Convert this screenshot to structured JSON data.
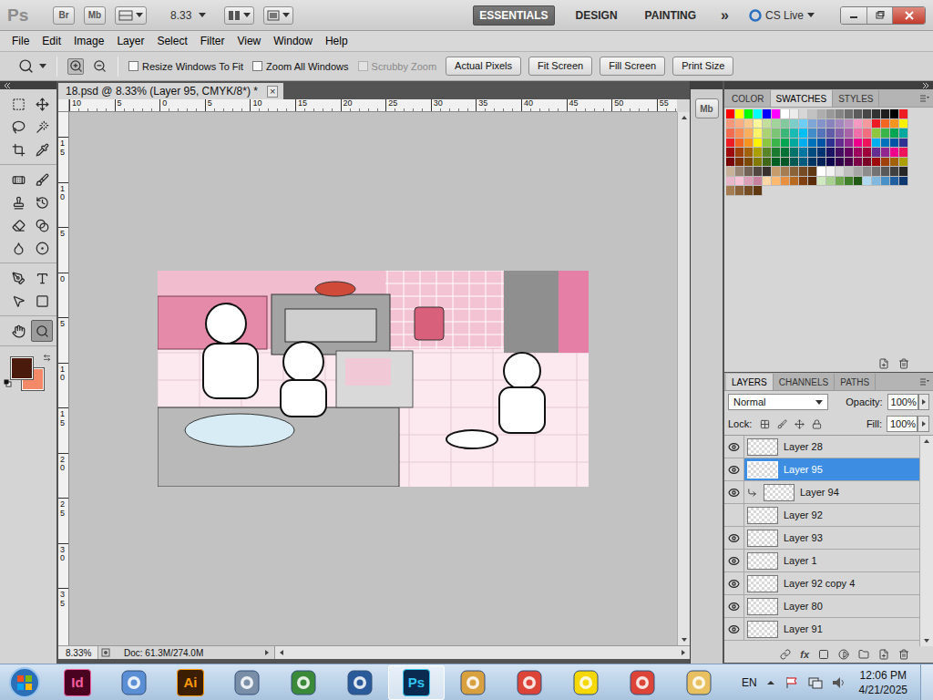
{
  "app_bar": {
    "logo": "Ps",
    "bridge": "Br",
    "mini_bridge": "Mb",
    "zoom": "8.33",
    "workspaces": [
      {
        "label": "ESSENTIALS",
        "selected": true
      },
      {
        "label": "DESIGN",
        "selected": false
      },
      {
        "label": "PAINTING",
        "selected": false
      }
    ],
    "more": "»",
    "cs_live": "CS Live"
  },
  "menu": [
    "File",
    "Edit",
    "Image",
    "Layer",
    "Select",
    "Filter",
    "View",
    "Window",
    "Help"
  ],
  "options": {
    "zoom_modes": [
      {
        "selected": true
      },
      {
        "selected": false
      }
    ],
    "checkboxes": [
      {
        "label": "Resize Windows To Fit",
        "checked": false,
        "disabled": false
      },
      {
        "label": "Zoom All Windows",
        "checked": false,
        "disabled": false
      },
      {
        "label": "Scrubby Zoom",
        "checked": false,
        "disabled": true
      }
    ],
    "buttons": [
      "Actual Pixels",
      "Fit Screen",
      "Fill Screen",
      "Print Size"
    ]
  },
  "tools": [
    {
      "selected": false
    },
    {
      "selected": false
    },
    {
      "selected": false
    },
    {
      "selected": false
    },
    {
      "selected": false
    },
    {
      "selected": false
    },
    {
      "selected": false
    },
    {
      "selected": false
    },
    {
      "selected": false
    },
    {
      "selected": false
    },
    {
      "selected": false
    },
    {
      "selected": false
    },
    {
      "selected": false
    },
    {
      "selected": false
    },
    {
      "selected": false
    },
    {
      "selected": false
    },
    {
      "selected": false
    },
    {
      "selected": false
    },
    {
      "selected": false
    },
    {
      "selected": true
    }
  ],
  "colors": {
    "foreground": "#4a1a0c",
    "background": "#f4896a"
  },
  "document": {
    "tab": "18.psd @ 8.33% (Layer 95, CMYK/8*) *",
    "close": "×",
    "ruler_top": [
      "10",
      "5",
      "0",
      "5",
      "10",
      "15",
      "20",
      "25",
      "30",
      "35",
      "40",
      "45",
      "50",
      "55"
    ],
    "ruler_left": [
      "15",
      "10",
      "5",
      "0",
      "5",
      "10",
      "15",
      "20",
      "25",
      "30",
      "35"
    ],
    "zoom": "8.33%",
    "info": "Doc: 61.3M/274.0M"
  },
  "dock": {
    "label": "Mb"
  },
  "swatches_panel": {
    "tabs": [
      {
        "label": "COLOR",
        "selected": false
      },
      {
        "label": "SWATCHES",
        "selected": true
      },
      {
        "label": "STYLES",
        "selected": false
      }
    ],
    "swatches": [
      [
        "#ff0000",
        "#ffff00",
        "#00ff00",
        "#00ffff",
        "#0000ff",
        "#ff00ff",
        "#ffffff",
        "#ebebeb",
        "#d6d6d6",
        "#c2c2c2",
        "#adadad",
        "#999999",
        "#858585",
        "#707070",
        "#5c5c5c",
        "#474747",
        "#333333",
        "#1f1f1f",
        "#000000",
        "#ee1d24"
      ],
      [
        "#f7977a",
        "#f9ad81",
        "#fdc68a",
        "#fff79a",
        "#c4df9b",
        "#a3d39c",
        "#82ca9d",
        "#7bcdc8",
        "#6ecff6",
        "#7ea7d8",
        "#8493ca",
        "#8882be",
        "#a187be",
        "#bc8dbf",
        "#f49ac2",
        "#f6989d",
        "#ed1c24",
        "#f26522",
        "#f7941d",
        "#fff200"
      ],
      [
        "#f26c4f",
        "#f68e55",
        "#fbaf5c",
        "#fff467",
        "#acd372",
        "#7cc576",
        "#3bb878",
        "#1abbb4",
        "#00bff3",
        "#438cca",
        "#5574b9",
        "#605ca8",
        "#855fa8",
        "#a763a8",
        "#f06ea9",
        "#f26d7d",
        "#8dc73f",
        "#39b54a",
        "#00a651",
        "#00a99d"
      ],
      [
        "#ed1c24",
        "#f26522",
        "#f7941d",
        "#fff200",
        "#8dc73f",
        "#39b54a",
        "#00a651",
        "#00a99d",
        "#00aeef",
        "#0072bc",
        "#0054a6",
        "#2e3192",
        "#662d91",
        "#92278f",
        "#ec008c",
        "#ed145b",
        "#00aeef",
        "#0072bc",
        "#0054a6",
        "#2e3192"
      ],
      [
        "#9e0b0f",
        "#a0410d",
        "#a36209",
        "#aba000",
        "#598527",
        "#1a7b30",
        "#007236",
        "#00746b",
        "#0076a3",
        "#004b80",
        "#003471",
        "#1b1464",
        "#440e62",
        "#630460",
        "#9e005d",
        "#9e0039",
        "#662d91",
        "#92278f",
        "#ec008c",
        "#ed145b"
      ],
      [
        "#790000",
        "#7b2e00",
        "#7d4900",
        "#827b00",
        "#406618",
        "#005e20",
        "#005826",
        "#005952",
        "#005b7f",
        "#003663",
        "#002157",
        "#0d004c",
        "#32004b",
        "#4b0049",
        "#7b0046",
        "#7a0026",
        "#9e0b0f",
        "#a0410d",
        "#a36209",
        "#aba000"
      ],
      [
        "#c7b299",
        "#998675",
        "#736357",
        "#534741",
        "#37302d",
        "#c69c6d",
        "#a67c52",
        "#8c6239",
        "#754c24",
        "#603913",
        "#ffffff",
        "#f2f2f2",
        "#d9d9d9",
        "#bfbfbf",
        "#a6a6a6",
        "#8c8c8c",
        "#737373",
        "#595959",
        "#404040",
        "#262626"
      ],
      [
        "#e8b7c9",
        "#f4c2d4",
        "#dba0b8",
        "#c7829f",
        "#ffd6a5",
        "#ffb870",
        "#e89040",
        "#b86a20",
        "#804010",
        "#5a2c0a",
        "#d0e8c0",
        "#a8d090",
        "#70a850",
        "#40802a",
        "#205a14",
        "#b0d8f0",
        "#80b8e0",
        "#4890c8",
        "#2060a0",
        "#103870"
      ],
      [
        "#a67c52",
        "#8c6239",
        "#754c24",
        "#603913"
      ]
    ]
  },
  "layers_panel": {
    "tabs": [
      {
        "label": "LAYERS",
        "selected": true
      },
      {
        "label": "CHANNELS",
        "selected": false
      },
      {
        "label": "PATHS",
        "selected": false
      }
    ],
    "blend_mode": "Normal",
    "opacity_label": "Opacity:",
    "opacity": "100%",
    "lock_label": "Lock:",
    "fill_label": "Fill:",
    "fill": "100%",
    "fx": "fx",
    "layers": [
      {
        "name": "Layer 28",
        "visible": true,
        "selected": false,
        "clipped": false
      },
      {
        "name": "Layer 95",
        "visible": true,
        "selected": true,
        "clipped": false
      },
      {
        "name": "Layer 94",
        "visible": true,
        "selected": false,
        "clipped": true
      },
      {
        "name": "Layer 92",
        "visible": false,
        "selected": false,
        "clipped": false
      },
      {
        "name": "Layer 93",
        "visible": true,
        "selected": false,
        "clipped": false
      },
      {
        "name": "Layer 1",
        "visible": true,
        "selected": false,
        "clipped": false
      },
      {
        "name": "Layer 92 copy 4",
        "visible": true,
        "selected": false,
        "clipped": false
      },
      {
        "name": "Layer 80",
        "visible": true,
        "selected": false,
        "clipped": false
      },
      {
        "name": "Layer 91",
        "visible": true,
        "selected": false,
        "clipped": false
      }
    ]
  },
  "taskbar": {
    "apps": [
      {
        "kind": "badge",
        "label": "Id",
        "color": "#49021f",
        "text_color": "#f25fa0",
        "selected": false
      },
      {
        "kind": "icon",
        "color": "#5a8fd6",
        "selected": false
      },
      {
        "kind": "badge",
        "label": "Ai",
        "color": "#3b1d00",
        "text_color": "#ff9a00",
        "selected": false
      },
      {
        "kind": "icon",
        "color": "#7a8ea8",
        "selected": false
      },
      {
        "kind": "icon",
        "color": "#3a8a3a",
        "selected": false
      },
      {
        "kind": "icon",
        "color": "#2a5a9a",
        "selected": false
      },
      {
        "kind": "badge",
        "label": "Ps",
        "color": "#0a2a4f",
        "text_color": "#31c5f0",
        "selected": true
      },
      {
        "kind": "icon",
        "color": "#d9a040",
        "selected": false
      },
      {
        "kind": "icon",
        "color": "#db4437",
        "selected": false
      },
      {
        "kind": "icon",
        "color": "#f5d800",
        "selected": false
      },
      {
        "kind": "icon",
        "color": "#db4437",
        "selected": false
      },
      {
        "kind": "icon",
        "color": "#e8c060",
        "selected": false
      }
    ],
    "language": "EN",
    "time": "12:06 PM",
    "date": "4/21/2025"
  }
}
